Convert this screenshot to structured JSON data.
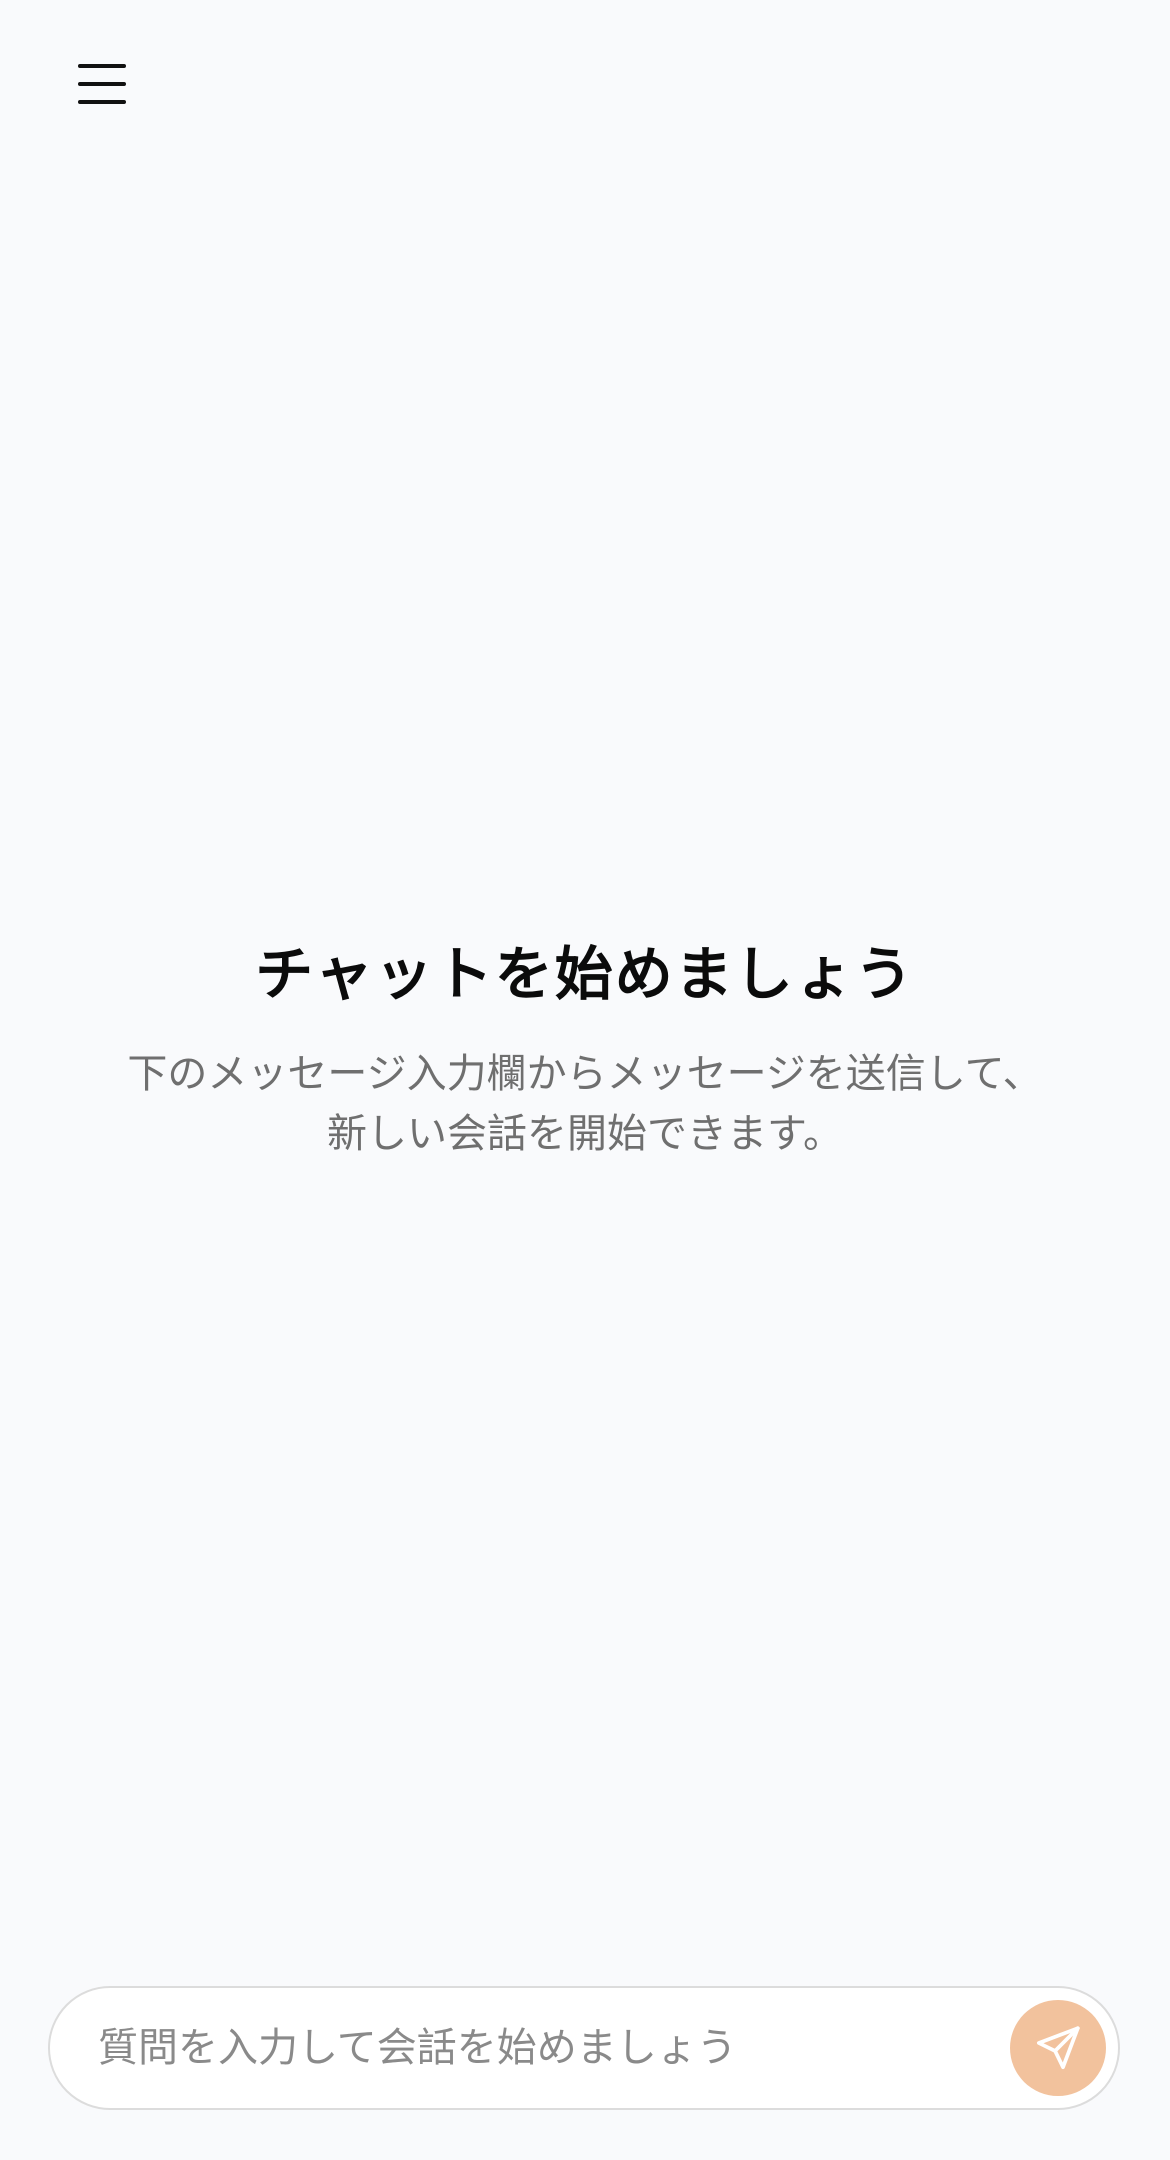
{
  "header": {
    "menu_icon": "hamburger-menu-icon"
  },
  "empty_state": {
    "title": "チャットを始めましょう",
    "subtitle_line1": "下のメッセージ入力欄からメッセージを送信して、",
    "subtitle_line2": "新しい会話を開始できます。"
  },
  "composer": {
    "placeholder": "質問を入力して会話を始めましょう",
    "value": "",
    "send_icon": "send-icon",
    "send_button_color": "#f2c29d"
  },
  "colors": {
    "background": "#f9fafc",
    "title": "#0b0b0b",
    "subtitle": "#6f6f6f",
    "accent": "#f2c29d"
  }
}
